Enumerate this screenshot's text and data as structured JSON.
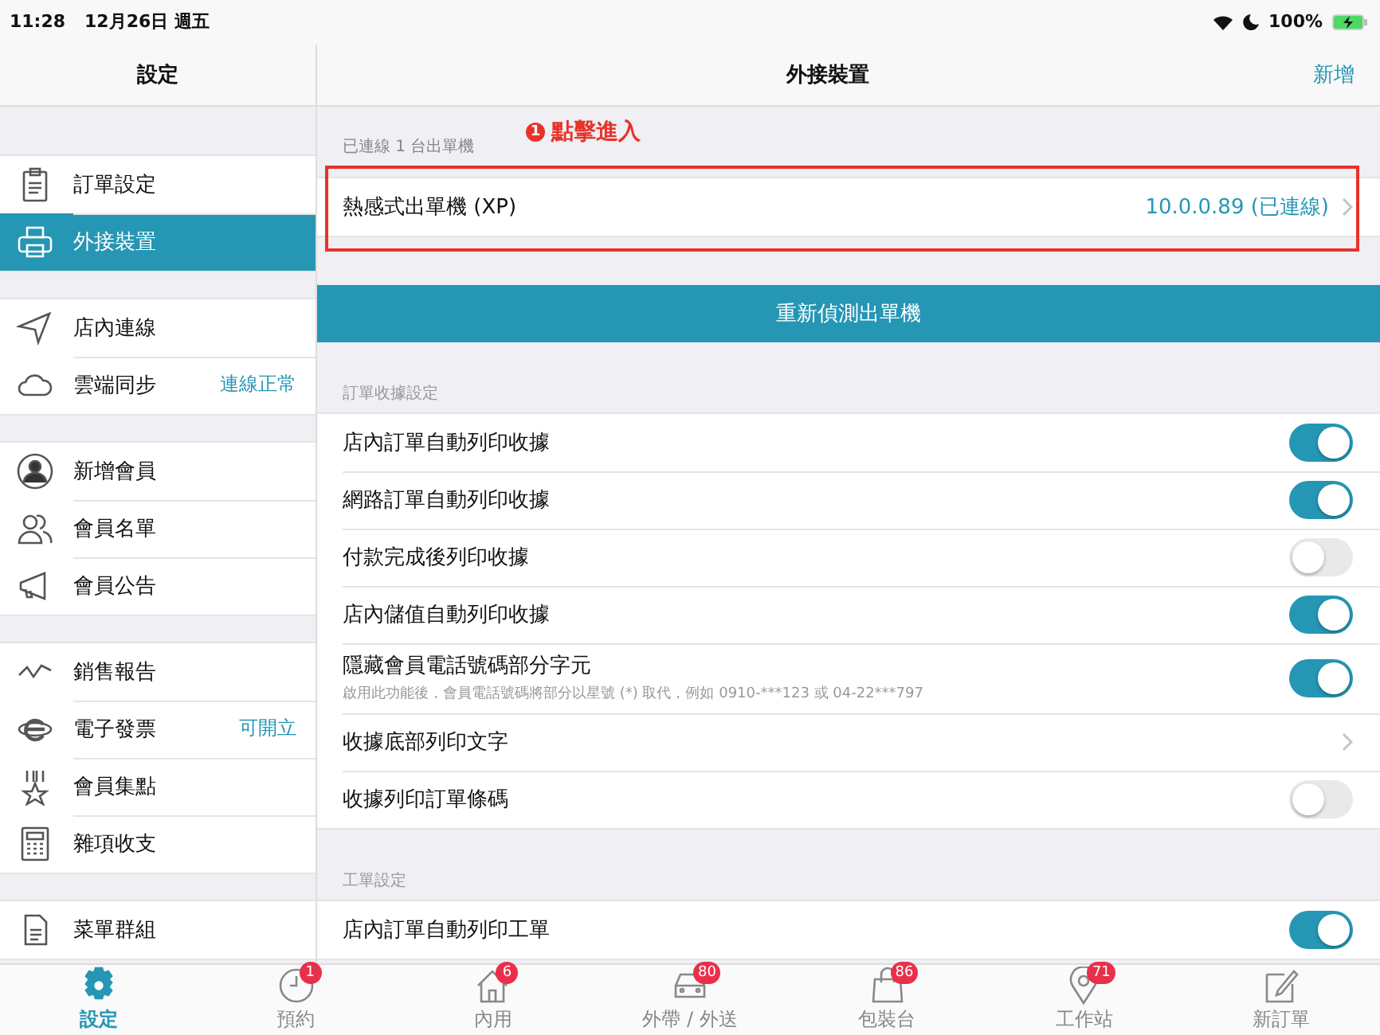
{
  "status_bar": {
    "time": "11:28",
    "date": "12月26日 週五",
    "battery": "100%"
  },
  "sidebar": {
    "title": "設定",
    "groups": [
      [
        {
          "label": "訂單設定",
          "selected": false
        },
        {
          "label": "外接裝置",
          "selected": true
        }
      ],
      [
        {
          "label": "店內連線",
          "selected": false
        },
        {
          "label": "雲端同步",
          "detail": "連線正常",
          "selected": false
        }
      ],
      [
        {
          "label": "新增會員",
          "selected": false
        },
        {
          "label": "會員名單",
          "selected": false
        },
        {
          "label": "會員公告",
          "selected": false
        }
      ],
      [
        {
          "label": "銷售報告",
          "selected": false
        },
        {
          "label": "電子發票",
          "detail": "可開立",
          "selected": false
        },
        {
          "label": "會員集點",
          "selected": false
        },
        {
          "label": "雜項收支",
          "selected": false
        }
      ],
      [
        {
          "label": "菜單群組",
          "selected": false
        }
      ]
    ]
  },
  "content": {
    "title": "外接裝置",
    "action": "新增",
    "printer_section": {
      "header": "已連線 1 台出單機",
      "printer": {
        "name": "熱感式出單機 (XP)",
        "status": "10.0.0.89 (已連線)"
      }
    },
    "redetect_button": "重新偵測出單機",
    "sections": [
      {
        "header": "訂單收據設定",
        "rows": [
          {
            "kind": "toggle",
            "label": "店內訂單自動列印收據",
            "on": true
          },
          {
            "kind": "toggle",
            "label": "網路訂單自動列印收據",
            "on": true
          },
          {
            "kind": "toggle",
            "label": "付款完成後列印收據",
            "on": false
          },
          {
            "kind": "toggle",
            "label": "店內儲值自動列印收據",
            "on": true
          },
          {
            "kind": "toggle",
            "label": "隱藏會員電話號碼部分字元",
            "note": "啟用此功能後，會員電話號碼將部分以星號 (*) 取代，例如 0910-***123 或 04-22***797",
            "on": true
          },
          {
            "kind": "link",
            "label": "收據底部列印文字"
          },
          {
            "kind": "toggle",
            "label": "收據列印訂單條碼",
            "on": false
          }
        ]
      },
      {
        "header": "工單設定",
        "rows": [
          {
            "kind": "toggle",
            "label": "店內訂單自動列印工單",
            "on": true
          }
        ]
      }
    ]
  },
  "annotation": {
    "number": "1",
    "text": "點擊進入"
  },
  "tab_bar": [
    {
      "label": "設定",
      "selected": true
    },
    {
      "label": "預約",
      "badge": "1",
      "selected": false
    },
    {
      "label": "內用",
      "badge": "6",
      "selected": false
    },
    {
      "label": "外帶 / 外送",
      "badge": "80",
      "selected": false
    },
    {
      "label": "包裝台",
      "badge": "86",
      "selected": false
    },
    {
      "label": "工作站",
      "badge": "71",
      "selected": false
    },
    {
      "label": "新訂單",
      "selected": false
    }
  ]
}
